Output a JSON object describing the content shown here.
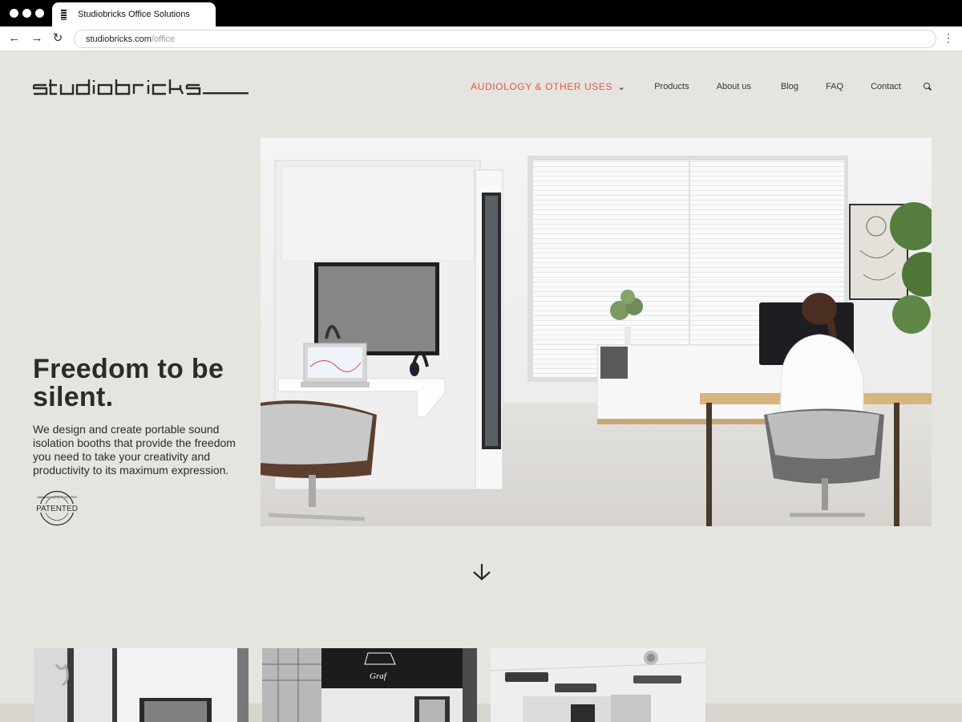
{
  "browser": {
    "tab_title": "Studiobricks Office Solutions",
    "url_host": "studiobricks.com",
    "url_path": "/office"
  },
  "header": {
    "logo_text": "studiobricks",
    "nav": {
      "audiology": "AUDIOLOGY & OTHER USES",
      "products": "Products",
      "about": "About us",
      "blog": "Blog",
      "faq": "FAQ",
      "contact": "Contact"
    },
    "accent_color": "#e2584f"
  },
  "hero": {
    "title": "Freedom to be silent.",
    "body": "We design and create portable sound isolation booths that provide the freedom you need to take your creativity and productivity to its maximum expression.",
    "badge_text": "PATENTED",
    "badge_ring_text": "Intellectual Property REGISTERED"
  },
  "scroll_icon": "arrow-down-icon",
  "background_color": "#e6e4df"
}
